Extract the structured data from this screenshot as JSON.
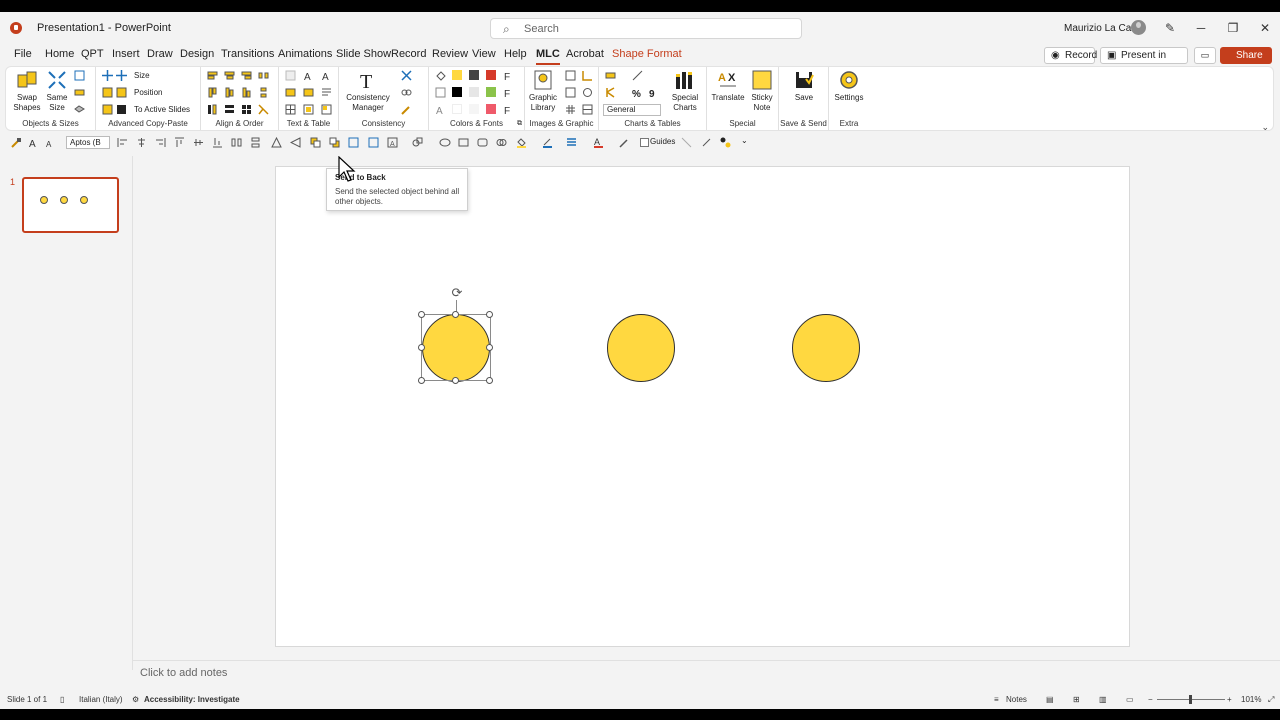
{
  "window": {
    "title": "Presentation1 - PowerPoint",
    "search_placeholder": "Search",
    "user_name": "Maurizio La Cava",
    "minimize": "─",
    "restore": "❐",
    "close": "✕"
  },
  "tabs": [
    "File",
    "Home",
    "QPT",
    "Insert",
    "Draw",
    "Design",
    "Transitions",
    "Animations",
    "Slide Show",
    "Record",
    "Review",
    "View",
    "Help",
    "MLC",
    "Acrobat",
    "Shape Format"
  ],
  "active_tab": "MLC",
  "title_actions": {
    "record": "Record",
    "present_in_teams": "Present in Teams",
    "share": "Share"
  },
  "ribbon": {
    "objects_sizes": {
      "label": "Objects & Sizes",
      "swap_shapes": "Swap Shapes",
      "same_size": "Same Size"
    },
    "advanced_copy_paste": {
      "label": "Advanced Copy-Paste",
      "size": "Size",
      "position": "Position",
      "to_active_slides": "To Active Slides"
    },
    "align_order": {
      "label": "Align & Order"
    },
    "text_table": {
      "label": "Text & Table"
    },
    "consistency": {
      "label": "Consistency",
      "manager": "Consistency Manager"
    },
    "colors_fonts": {
      "label": "Colors & Fonts"
    },
    "images_graphic": {
      "label": "Images & Graphic",
      "graphic_library": "Graphic Library"
    },
    "charts_tables": {
      "label": "Charts & Tables",
      "number_format": "General",
      "special_charts": "Special Charts"
    },
    "special": {
      "label": "Special",
      "translate": "Translate",
      "sticky_note": "Sticky Note"
    },
    "save_send": {
      "label": "Save & Send",
      "save": "Save"
    },
    "extra": {
      "label": "Extra",
      "settings": "Settings"
    }
  },
  "quick_toolbar": {
    "font": "Aptos (B",
    "guides": "Guides"
  },
  "tooltip": {
    "title": "Send to Back",
    "description": "Send the selected object behind all other objects."
  },
  "slides_panel": {
    "slide_number": "1"
  },
  "notes": {
    "placeholder": "Click to add notes"
  },
  "status_bar": {
    "slide_info": "Slide 1 of 1",
    "language": "Italian (Italy)",
    "accessibility": "Accessibility: Investigate",
    "notes": "Notes",
    "zoom": "101%"
  },
  "colors": {
    "accent": "#c43e1c",
    "shape_fill": "#ffd840",
    "shape_outline": "#2f2f2f"
  }
}
